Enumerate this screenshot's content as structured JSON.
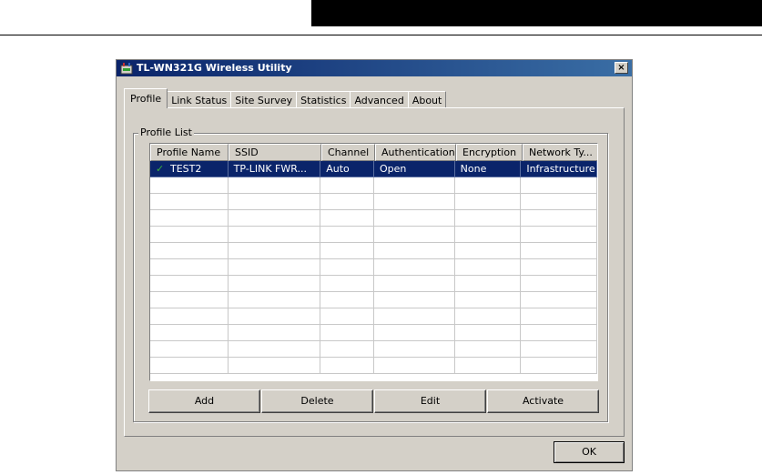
{
  "window": {
    "title": "TL-WN321G Wireless Utility",
    "close_symbol": "×"
  },
  "tabs": [
    {
      "label": "Profile",
      "active": true
    },
    {
      "label": "Link Status",
      "active": false
    },
    {
      "label": "Site Survey",
      "active": false
    },
    {
      "label": "Statistics",
      "active": false
    },
    {
      "label": "Advanced",
      "active": false
    },
    {
      "label": "About",
      "active": false
    }
  ],
  "profile_list": {
    "group_label": "Profile List",
    "columns": [
      "Profile Name",
      "SSID",
      "Channel",
      "Authentication",
      "Encryption",
      "Network Ty..."
    ],
    "rows": [
      {
        "profile_name": "TEST2",
        "ssid": "TP-LINK FWR...",
        "channel": "Auto",
        "authentication": "Open",
        "encryption": "None",
        "network_type": "Infrastructure",
        "selected": true,
        "icon": "check-icon"
      }
    ]
  },
  "buttons": {
    "add": "Add",
    "delete": "Delete",
    "edit": "Edit",
    "activate": "Activate",
    "ok": "OK"
  },
  "colors": {
    "title_bar": "#0a246a",
    "selection": "#0a246a",
    "dialog_bg": "#d4d0c8",
    "check_green": "#3ab03a"
  }
}
